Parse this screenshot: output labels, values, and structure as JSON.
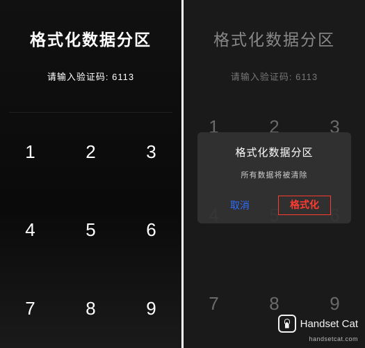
{
  "left": {
    "title": "格式化数据分区",
    "prompt": "请输入验证码: 6113",
    "keypad": [
      "1",
      "2",
      "3",
      "4",
      "5",
      "6",
      "7",
      "8",
      "9"
    ]
  },
  "right": {
    "title": "格式化数据分区",
    "prompt": "请输入验证码: 6113",
    "keypad": [
      "1",
      "2",
      "3",
      "4",
      "5",
      "6",
      "7",
      "8",
      "9"
    ],
    "dialog": {
      "title": "格式化数据分区",
      "message": "所有数据将被清除",
      "cancel": "取消",
      "confirm": "格式化"
    }
  },
  "watermark": {
    "brand": "Handset Cat",
    "url": "handsetcat.com"
  }
}
